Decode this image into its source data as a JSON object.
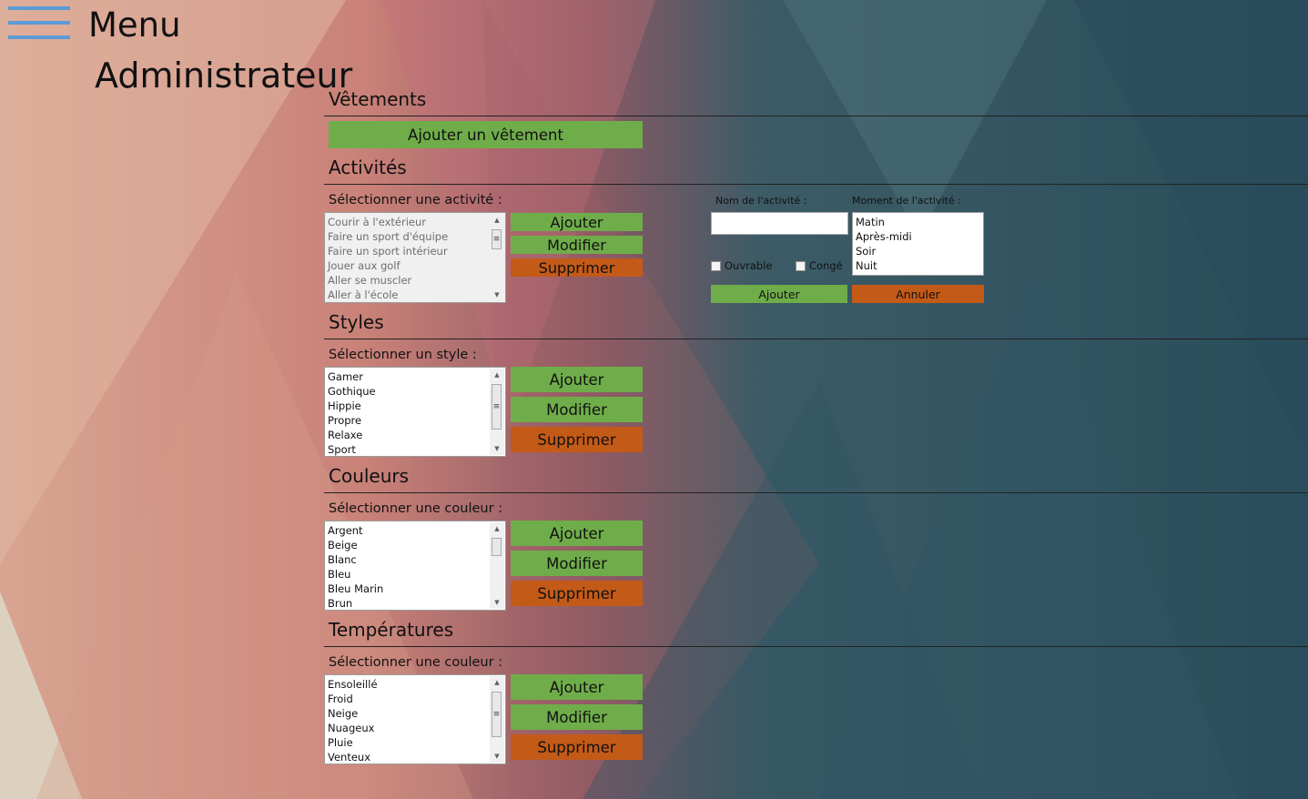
{
  "header": {
    "menu_label": "Menu",
    "page_title": "Administrateur"
  },
  "vetements": {
    "title": "Vêtements",
    "add_button": "Ajouter un vêtement"
  },
  "activites": {
    "title": "Activités",
    "select_label": "Sélectionner une activité :",
    "items": [
      "Courir à l'extérieur",
      "Faire un sport d'équipe",
      "Faire un sport intérieur",
      "Jouer aux golf",
      "Aller se muscler",
      "Aller à l'école"
    ],
    "buttons": {
      "add": "Ajouter",
      "edit": "Modifier",
      "delete": "Supprimer"
    },
    "form": {
      "name_label": "Nom de l'activité :",
      "name_value": "",
      "moment_label": "Moment de l'activité :",
      "moments": [
        "Matin",
        "Après-midi",
        "Soir",
        "Nuit"
      ],
      "ouvrable_label": "Ouvrable",
      "conge_label": "Congé",
      "add_button": "Ajouter",
      "cancel_button": "Annuler"
    }
  },
  "styles": {
    "title": "Styles",
    "select_label": "Sélectionner un style :",
    "items": [
      "Gamer",
      "Gothique",
      "Hippie",
      "Propre",
      "Relaxe",
      "Sport"
    ],
    "buttons": {
      "add": "Ajouter",
      "edit": "Modifier",
      "delete": "Supprimer"
    }
  },
  "couleurs": {
    "title": "Couleurs",
    "select_label": "Sélectionner une couleur :",
    "items": [
      "Argent",
      "Beige",
      "Blanc",
      "Bleu",
      "Bleu Marin",
      "Brun"
    ],
    "buttons": {
      "add": "Ajouter",
      "edit": "Modifier",
      "delete": "Supprimer"
    }
  },
  "temperatures": {
    "title": "Températures",
    "select_label": "Sélectionner une couleur :",
    "items": [
      "Ensoleillé",
      "Froid",
      "Neige",
      "Nuageux",
      "Pluie",
      "Venteux"
    ],
    "buttons": {
      "add": "Ajouter",
      "edit": "Modifier",
      "delete": "Supprimer"
    }
  },
  "icons": {
    "menu": "hamburger-icon",
    "scroll_up": "chevron-up-icon",
    "scroll_down": "chevron-down-icon",
    "scroll_grip": "grip-icon"
  },
  "colors": {
    "accent_green": "#6fad4a",
    "accent_orange": "#c45a18",
    "hamburger_blue": "#5b9bd5"
  }
}
